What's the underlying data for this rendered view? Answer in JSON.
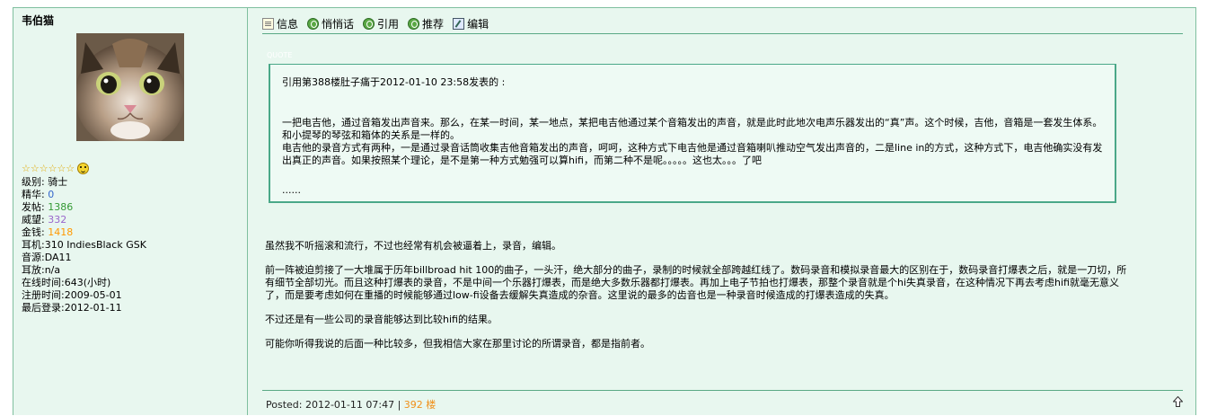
{
  "user": {
    "name": "韦伯猫",
    "stars": "☆☆☆☆☆☆",
    "level": "级别: 骑士",
    "elite_label": "精华: ",
    "elite_value": "0",
    "posts_label": "发帖: ",
    "posts_value": "1386",
    "prestige_label": "威望: ",
    "prestige_value": "332",
    "money_label": "金钱: ",
    "money_value": "1418",
    "headphone": "耳机:310 IndiesBlack GSK",
    "source": "音源:DA11",
    "amp": "耳放:n/a",
    "online": "在线时间:643(小时)",
    "registered": "注册时间:2009-05-01",
    "last_login": "最后登录:2012-01-11"
  },
  "toolbar": {
    "info": "信息",
    "whisper": "悄悄话",
    "quote": "引用",
    "recommend": "推荐",
    "edit": "编辑"
  },
  "quote": {
    "label": "QUOTE",
    "header": "引用第388楼肚子痛于2012-01-10 23:58发表的 :",
    "body": "一把电吉他，通过音箱发出声音来。那么，在某一时间，某一地点，某把电吉他通过某个音箱发出的声音，就是此时此地次电声乐器发出的“真”声。这个时候，吉他，音箱是一套发生体系。和小提琴的琴弦和箱体的关系是一样的。",
    "body2": "电吉他的录音方式有两种，一是通过录音话筒收集吉他音箱发出的声音，呵呵，这种方式下电吉他是通过音箱喇叭推动空气发出声音的，二是line in的方式，这种方式下，电吉他确实没有发出真正的声音。如果按照某个理论，是不是第一种方式勉强可以算hifi，而第二种不是呢。。。。。这也太。。。了吧",
    "ellipsis": "......"
  },
  "post": {
    "p1": "虽然我不听摇滚和流行，不过也经常有机会被逼着上，录音，编辑。",
    "p2": "前一阵被迫剪接了一大堆属于历年billbroad hit 100的曲子，一头汗，绝大部分的曲子，录制的时候就全部跨越红线了。数码录音和模拟录音最大的区别在于，数码录音打爆表之后，就是一刀切，所有细节全部切光。而且这种打爆表的录音，不是中间一个乐器打爆表，而是绝大多数乐器都打爆表。再加上电子节拍也打爆表，那整个录音就是个hi失真录音，在这种情况下再去考虑hifi就毫无意义了，而是要考虑如何在重播的时候能够通过low-fi设备去缓解失真造成的杂音。这里说的最多的齿音也是一种录音时候造成的打爆表造成的失真。",
    "p3": "不过还是有一些公司的录音能够达到比较hifi的结果。",
    "p4": "可能你听得我说的后面一种比较多，但我相信大家在那里讨论的所谓录音，都是指前者。"
  },
  "footer": {
    "posted": "Posted: 2012-01-11 07:47 | ",
    "floor": "392 楼"
  },
  "colors": {
    "background": "#e8f7ef",
    "border": "#5aa985",
    "elite": "#3366cc",
    "posts": "#339933",
    "prestige": "#9966cc",
    "money": "#ff9900",
    "floor": "#f0901a"
  }
}
